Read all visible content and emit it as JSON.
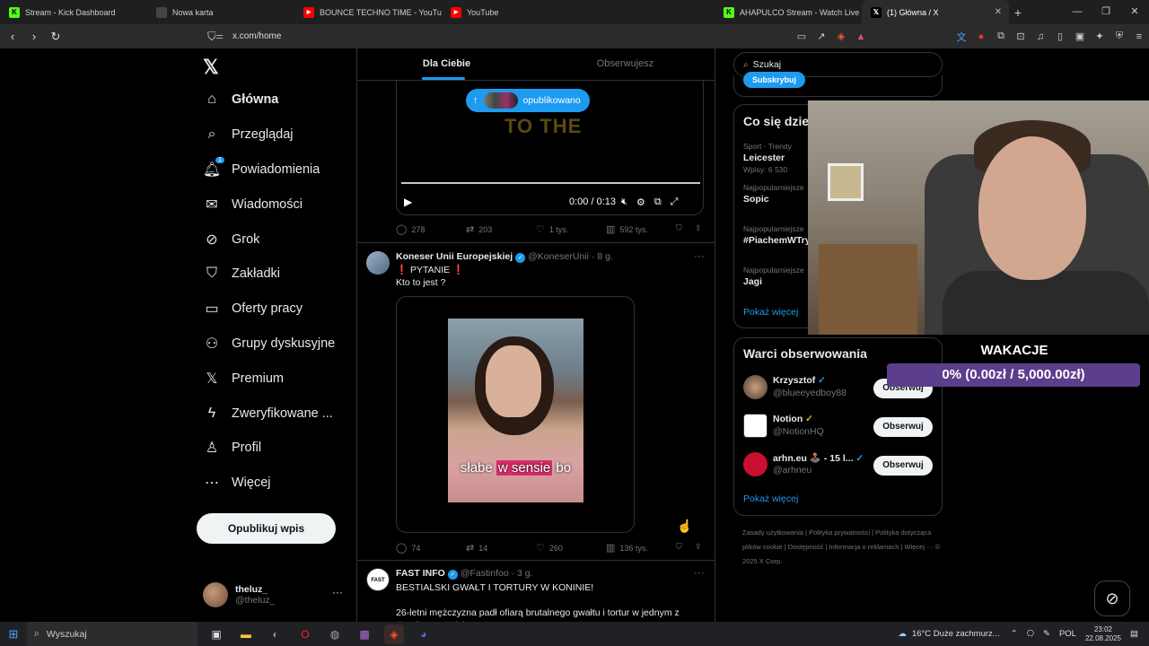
{
  "browser": {
    "tabs": [
      {
        "label": "Stream - Kick Dashboard",
        "icon": "kick-icon",
        "color": "#53fc18"
      },
      {
        "label": "Nowa karta",
        "icon": "blank-icon",
        "color": "#444444"
      },
      {
        "label": "BOUNCE TECHNO TIME - YouTube",
        "icon": "youtube-icon",
        "color": "#ff0000"
      },
      {
        "label": "YouTube",
        "icon": "youtube-icon",
        "color": "#ff0000"
      },
      {
        "label": "AHAPULCO Stream - Watch Live on K",
        "icon": "kick-icon",
        "color": "#53fc18"
      },
      {
        "label": "(1) Główna / X",
        "icon": "x-icon",
        "color": "#000000"
      }
    ],
    "url": "x.com/home"
  },
  "nav": {
    "items": [
      {
        "label": "Główna",
        "icon": "home-icon",
        "glyph": "⌂",
        "bold": true
      },
      {
        "label": "Przeglądaj",
        "icon": "search-icon",
        "glyph": "⌕"
      },
      {
        "label": "Powiadomienia",
        "icon": "bell-icon",
        "glyph": "🔔︎",
        "badge": "1"
      },
      {
        "label": "Wiadomości",
        "icon": "mail-icon",
        "glyph": "✉"
      },
      {
        "label": "Grok",
        "icon": "grok-icon",
        "glyph": "⊘"
      },
      {
        "label": "Zakładki",
        "icon": "bookmark-icon",
        "glyph": "⛉"
      },
      {
        "label": "Oferty pracy",
        "icon": "briefcase-icon",
        "glyph": "▭"
      },
      {
        "label": "Grupy dyskusyjne",
        "icon": "people-icon",
        "glyph": "⚇"
      },
      {
        "label": "Premium",
        "icon": "x-premium-icon",
        "glyph": "𝕏"
      },
      {
        "label": "Zweryfikowane ...",
        "icon": "lightning-icon",
        "glyph": "ϟ"
      },
      {
        "label": "Profil",
        "icon": "person-icon",
        "glyph": "♙"
      },
      {
        "label": "Więcej",
        "icon": "more-circle-icon",
        "glyph": "⋯"
      }
    ],
    "post_button": "Opublikuj wpis",
    "account": {
      "display_name": "theluz_",
      "handle": "@theluz_"
    }
  },
  "feed": {
    "tabs": [
      "Dla Ciebie",
      "Obserwujesz"
    ],
    "new_posts_pill": "opublikowano",
    "video_overlay_text": "TO THE",
    "video_time": "0:00 / 0:13",
    "post1_actions": {
      "replies": "278",
      "reposts": "203",
      "likes": "1 tys.",
      "views": "592 tys."
    },
    "post2": {
      "name": "Koneser Unii Europejskiej",
      "handle": "@KoneserUnii",
      "time": "· 8 g.",
      "text": "❗ PYTANIE ❗\nKto to jest ?",
      "caption_a": "słabe ",
      "caption_b": "w sensie",
      "caption_c": " bo",
      "actions": {
        "replies": "74",
        "reposts": "14",
        "likes": "260",
        "views": "136 tys."
      }
    },
    "post3": {
      "name": "FAST INFO",
      "handle": "@Fastinfoo",
      "time": "· 3 g.",
      "text": "BESTIALSKI GWAŁT I TORTURY W KONINIE!\n\n26-letni mężczyzna padł ofiarą brutalnego gwałtu i tortur w jednym z domów w Koninie"
    }
  },
  "sidebar": {
    "search_value": "Szukaj",
    "subscribe_button": "Subskrybuj",
    "trends_title": "Co się dzieje",
    "trends": [
      {
        "context": "Sport · Trendy",
        "title": "Leicester",
        "posts": "Wpisy: 6 530"
      },
      {
        "context": "Najpopularniejsze",
        "title": "Sopic",
        "posts": ""
      },
      {
        "context": "Najpopularniejsze",
        "title": "#PiachemWTry",
        "posts": ""
      },
      {
        "context": "Najpopularniejsze",
        "title": "Jagi",
        "posts": ""
      }
    ],
    "trends_more": "Pokaż więcej",
    "follow_title": "Warci obserwowania",
    "follow": [
      {
        "name": "Krzysztof",
        "handle": "@blueeyedboy88",
        "button": "Obserwuj",
        "badge": "blue"
      },
      {
        "name": "Notion",
        "handle": "@NotionHQ",
        "button": "Obserwuj",
        "badge": "gold"
      },
      {
        "name": "arhn.eu 🕹️ - 15 l...",
        "handle": "@arhneu",
        "button": "Obserwuj",
        "badge": "blue"
      }
    ],
    "follow_more": "Pokaż więcej",
    "footer": "Zasady użytkowania | Polityka prywatności | Polityka dotycząca plików cookie | Dostępność | Informacja o reklamach | Więcej ··· © 2025 X Corp."
  },
  "overlay": {
    "title": "WAKACJE",
    "goal": "0% (0.00zł / 5,000.00zł)",
    "goal_fraction": 0
  },
  "taskbar": {
    "search": "Wyszukaj",
    "weather": "16°C  Duże zachmurz...",
    "lang": "POL",
    "time": "23:02",
    "date": "22.08.2025"
  }
}
